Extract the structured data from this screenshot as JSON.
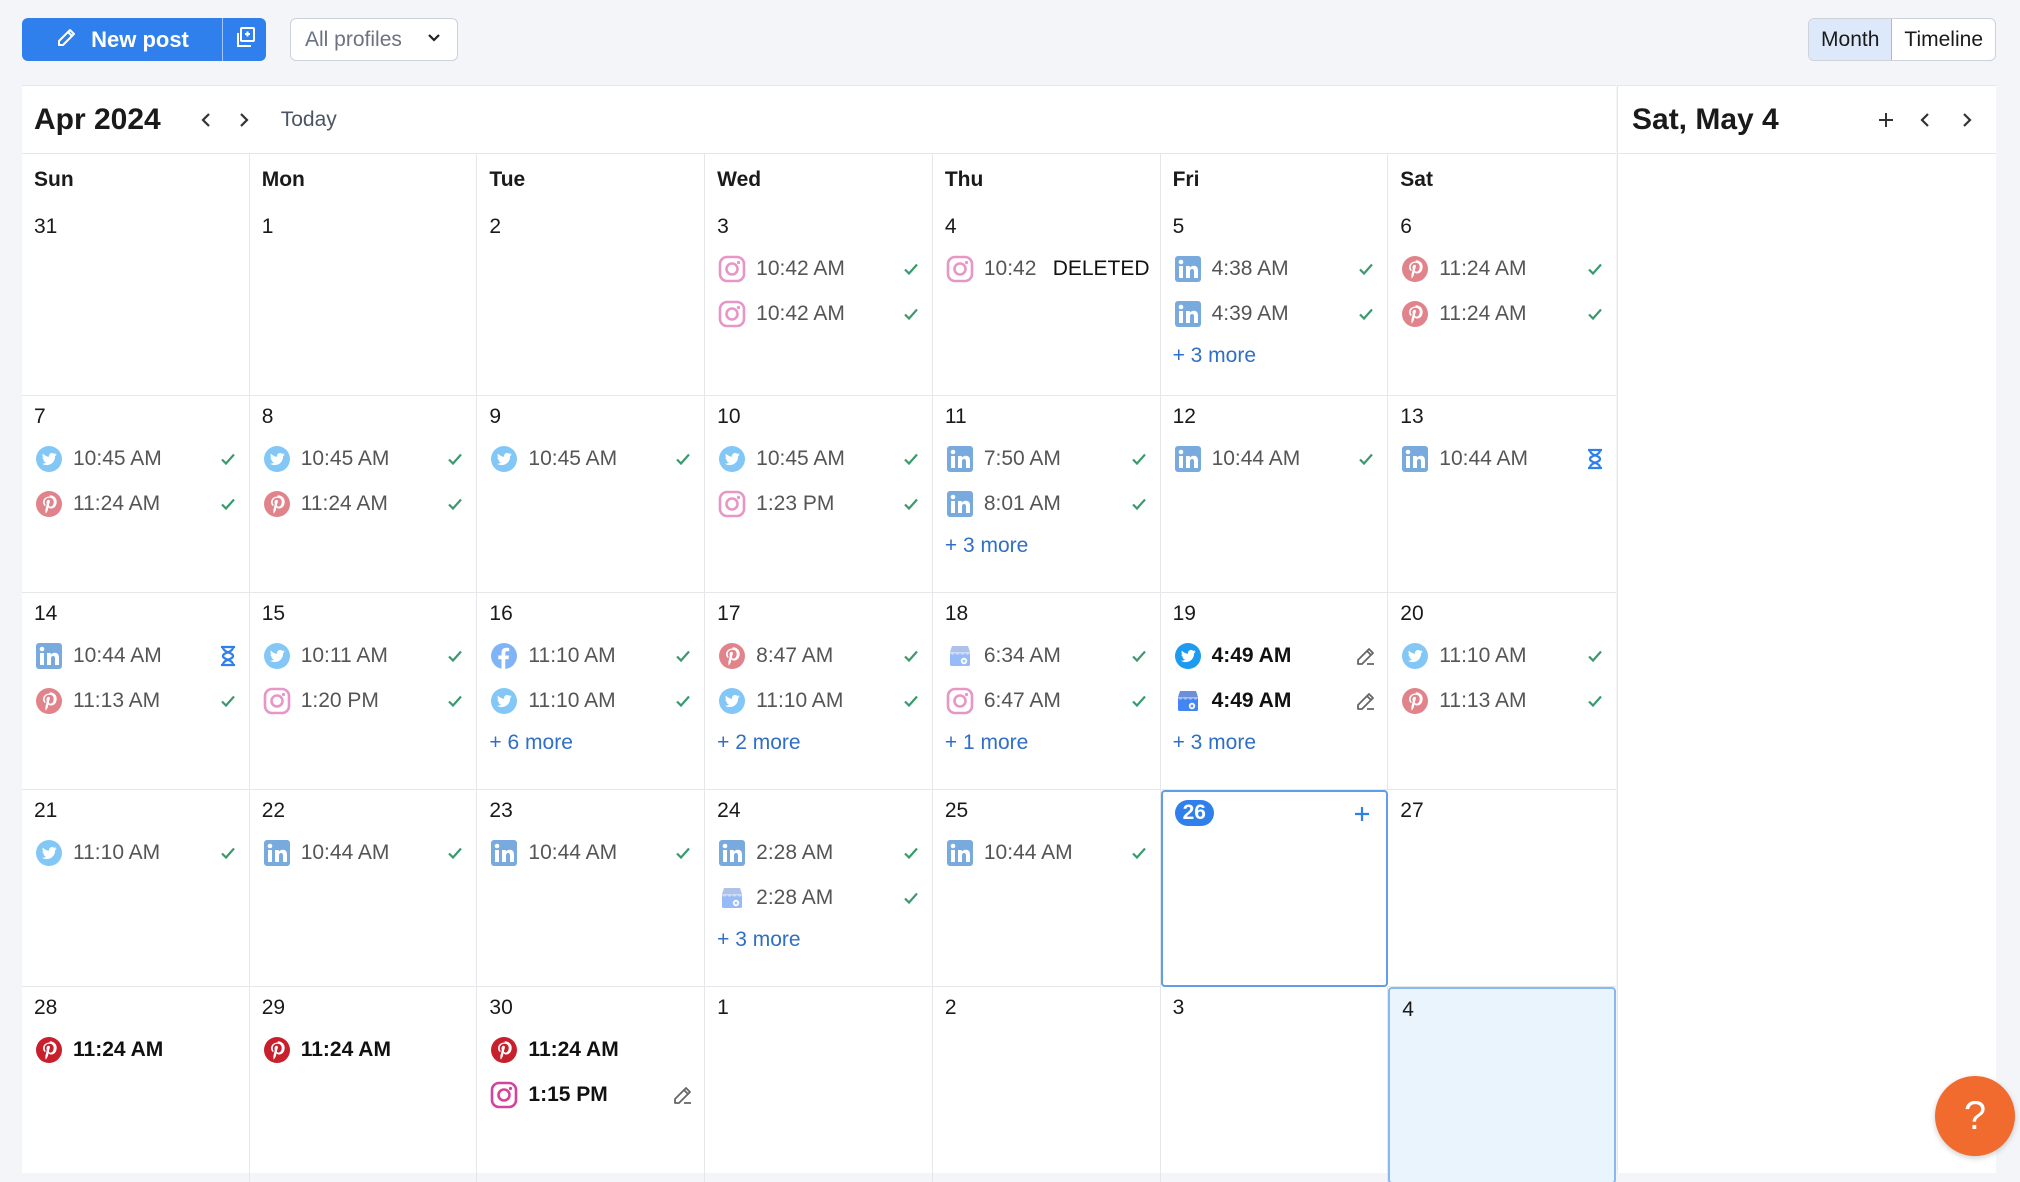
{
  "toolbar": {
    "new_post_label": "New post",
    "profiles_label": "All profiles",
    "view_month": "Month",
    "view_timeline": "Timeline"
  },
  "calendar": {
    "title": "Apr 2024",
    "today_label": "Today",
    "weekdays": [
      "Sun",
      "Mon",
      "Tue",
      "Wed",
      "Thu",
      "Fri",
      "Sat"
    ],
    "weeks": [
      [
        {
          "date": "31",
          "posts": []
        },
        {
          "date": "1",
          "posts": []
        },
        {
          "date": "2",
          "posts": []
        },
        {
          "date": "3",
          "posts": [
            {
              "network": "instagram",
              "time": "10:42 AM",
              "status": "published"
            },
            {
              "network": "instagram",
              "time": "10:42 AM",
              "status": "published"
            }
          ]
        },
        {
          "date": "4",
          "posts": [
            {
              "network": "instagram",
              "time": "10:42",
              "status": "deleted",
              "tag": "DELETED"
            }
          ]
        },
        {
          "date": "5",
          "posts": [
            {
              "network": "linkedin",
              "time": "4:38 AM",
              "status": "published"
            },
            {
              "network": "linkedin",
              "time": "4:39 AM",
              "status": "published"
            }
          ],
          "more": "+ 3 more"
        },
        {
          "date": "6",
          "posts": [
            {
              "network": "pinterest",
              "time": "11:24 AM",
              "status": "published"
            },
            {
              "network": "pinterest",
              "time": "11:24 AM",
              "status": "published"
            }
          ]
        }
      ],
      [
        {
          "date": "7",
          "posts": [
            {
              "network": "twitter",
              "time": "10:45 AM",
              "status": "published"
            },
            {
              "network": "pinterest",
              "time": "11:24 AM",
              "status": "published"
            }
          ]
        },
        {
          "date": "8",
          "posts": [
            {
              "network": "twitter",
              "time": "10:45 AM",
              "status": "published"
            },
            {
              "network": "pinterest",
              "time": "11:24 AM",
              "status": "published"
            }
          ]
        },
        {
          "date": "9",
          "posts": [
            {
              "network": "twitter",
              "time": "10:45 AM",
              "status": "published"
            }
          ]
        },
        {
          "date": "10",
          "posts": [
            {
              "network": "twitter",
              "time": "10:45 AM",
              "status": "published"
            },
            {
              "network": "instagram",
              "time": "1:23 PM",
              "status": "published"
            }
          ]
        },
        {
          "date": "11",
          "posts": [
            {
              "network": "linkedin",
              "time": "7:50 AM",
              "status": "published"
            },
            {
              "network": "linkedin",
              "time": "8:01 AM",
              "status": "published"
            }
          ],
          "more": "+ 3 more"
        },
        {
          "date": "12",
          "posts": [
            {
              "network": "linkedin",
              "time": "10:44 AM",
              "status": "published"
            }
          ]
        },
        {
          "date": "13",
          "posts": [
            {
              "network": "linkedin",
              "time": "10:44 AM",
              "status": "pending"
            }
          ]
        }
      ],
      [
        {
          "date": "14",
          "posts": [
            {
              "network": "linkedin",
              "time": "10:44 AM",
              "status": "pending"
            },
            {
              "network": "pinterest",
              "time": "11:13 AM",
              "status": "published"
            }
          ]
        },
        {
          "date": "15",
          "posts": [
            {
              "network": "twitter",
              "time": "10:11 AM",
              "status": "published"
            },
            {
              "network": "instagram",
              "time": "1:20 PM",
              "status": "published"
            }
          ]
        },
        {
          "date": "16",
          "posts": [
            {
              "network": "facebook",
              "time": "11:10 AM",
              "status": "published"
            },
            {
              "network": "twitter",
              "time": "11:10 AM",
              "status": "published"
            }
          ],
          "more": "+ 6 more"
        },
        {
          "date": "17",
          "posts": [
            {
              "network": "pinterest",
              "time": "8:47 AM",
              "status": "published"
            },
            {
              "network": "twitter",
              "time": "11:10 AM",
              "status": "published"
            }
          ],
          "more": "+ 2 more"
        },
        {
          "date": "18",
          "posts": [
            {
              "network": "gmb",
              "time": "6:34 AM",
              "status": "published"
            },
            {
              "network": "instagram",
              "time": "6:47 AM",
              "status": "published"
            }
          ],
          "more": "+ 1 more"
        },
        {
          "date": "19",
          "posts": [
            {
              "network": "twitter",
              "time": "4:49 AM",
              "status": "draft"
            },
            {
              "network": "gmb",
              "time": "4:49 AM",
              "status": "draft"
            }
          ],
          "more": "+ 3 more"
        },
        {
          "date": "20",
          "posts": [
            {
              "network": "twitter",
              "time": "11:10 AM",
              "status": "published"
            },
            {
              "network": "pinterest",
              "time": "11:13 AM",
              "status": "published"
            }
          ]
        }
      ],
      [
        {
          "date": "21",
          "posts": [
            {
              "network": "twitter",
              "time": "11:10 AM",
              "status": "published"
            }
          ]
        },
        {
          "date": "22",
          "posts": [
            {
              "network": "linkedin",
              "time": "10:44 AM",
              "status": "published"
            }
          ]
        },
        {
          "date": "23",
          "posts": [
            {
              "network": "linkedin",
              "time": "10:44 AM",
              "status": "published"
            }
          ]
        },
        {
          "date": "24",
          "posts": [
            {
              "network": "linkedin",
              "time": "2:28 AM",
              "status": "published"
            },
            {
              "network": "gmb",
              "time": "2:28 AM",
              "status": "published"
            }
          ],
          "more": "+ 3 more"
        },
        {
          "date": "25",
          "posts": [
            {
              "network": "linkedin",
              "time": "10:44 AM",
              "status": "published"
            }
          ]
        },
        {
          "date": "26",
          "posts": [],
          "today": true
        },
        {
          "date": "27",
          "posts": []
        }
      ],
      [
        {
          "date": "28",
          "posts": [
            {
              "network": "pinterest",
              "time": "11:24 AM",
              "status": "scheduled"
            }
          ]
        },
        {
          "date": "29",
          "posts": [
            {
              "network": "pinterest",
              "time": "11:24 AM",
              "status": "scheduled"
            }
          ]
        },
        {
          "date": "30",
          "posts": [
            {
              "network": "pinterest",
              "time": "11:24 AM",
              "status": "scheduled"
            },
            {
              "network": "instagram",
              "time": "1:15 PM",
              "status": "draft"
            }
          ]
        },
        {
          "date": "1",
          "posts": []
        },
        {
          "date": "2",
          "posts": []
        },
        {
          "date": "3",
          "posts": []
        },
        {
          "date": "4",
          "posts": [],
          "selected": true
        }
      ]
    ]
  },
  "side_panel": {
    "title": "Sat, May 4"
  },
  "help": {
    "label": "?"
  },
  "colors": {
    "accent": "#2f80ed",
    "check": "#3a9a6e",
    "instagram": "#d6429a",
    "linkedin": "#0a66c2",
    "pinterest": "#c81f2d",
    "twitter": "#1d9bf0",
    "facebook": "#1877f2",
    "gmb": "#4285f4",
    "help": "#f16a2e"
  }
}
